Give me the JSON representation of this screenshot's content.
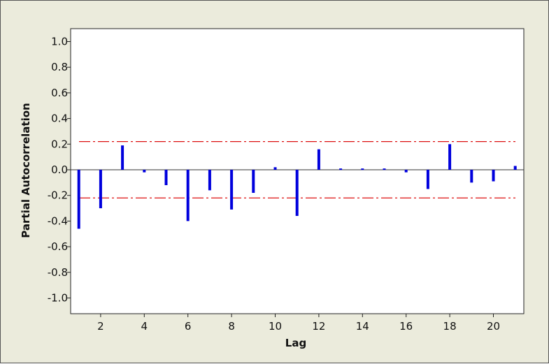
{
  "chart_data": {
    "type": "bar",
    "xlabel": "Lag",
    "ylabel": "Partial Autocorrelation",
    "ylim": [
      -1.1,
      1.1
    ],
    "xlim": [
      0,
      21
    ],
    "y_ticks": [
      1.0,
      0.8,
      0.6,
      0.4,
      0.2,
      0.0,
      -0.2,
      -0.4,
      -0.6,
      -0.8,
      -1.0
    ],
    "y_tick_labels": [
      "1.0",
      "0.8",
      "0.6",
      "0.4",
      "0.2",
      "0.0",
      "-0.2",
      "-0.4",
      "-0.6",
      "-0.8",
      "-1.0"
    ],
    "x_ticks": [
      2,
      4,
      6,
      8,
      10,
      12,
      14,
      16,
      18,
      20
    ],
    "x_tick_labels": [
      "2",
      "4",
      "6",
      "8",
      "10",
      "12",
      "14",
      "16",
      "18",
      "20"
    ],
    "lags": [
      1,
      2,
      3,
      4,
      5,
      6,
      7,
      8,
      9,
      10,
      11,
      12,
      13,
      14,
      15,
      16,
      17,
      18,
      19,
      20,
      21
    ],
    "values": [
      -0.46,
      -0.3,
      0.19,
      -0.02,
      -0.12,
      -0.4,
      -0.16,
      -0.31,
      -0.18,
      0.02,
      -0.36,
      0.16,
      0.01,
      0.01,
      0.01,
      -0.02,
      -0.15,
      0.2,
      -0.1,
      -0.09,
      0.03
    ],
    "significance_limits": [
      0.22,
      -0.22
    ],
    "grid": false,
    "colors": {
      "bars": "#0000dd",
      "limits": "#dd1111",
      "zero_line": "#333333",
      "background": "#ebebdc",
      "plot_area": "#ffffff"
    }
  }
}
